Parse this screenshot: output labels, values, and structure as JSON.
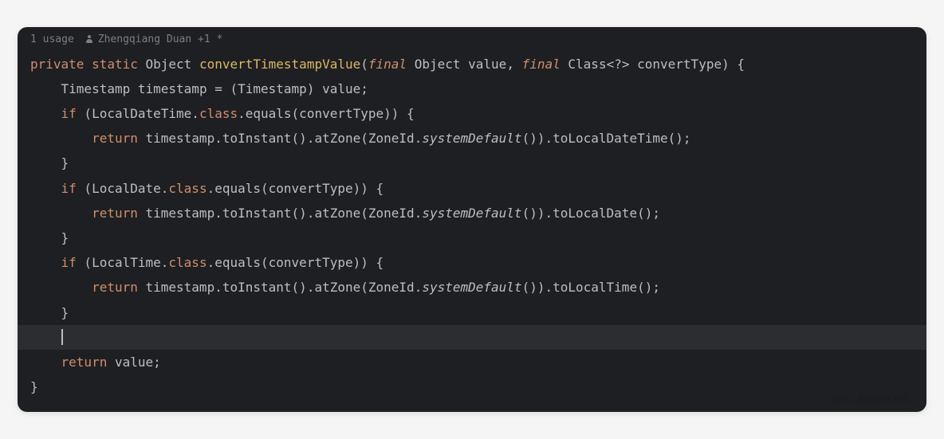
{
  "header": {
    "usage": "1 usage",
    "author": "Zhengqiang Duan +1 *"
  },
  "code": {
    "line1": {
      "kw1": "private",
      "kw2": "static",
      "type1": "Object",
      "method": "convertTimestampValue",
      "paren_open": "(",
      "kw3": "final",
      "type2": "Object",
      "param1": "value",
      "comma1": ",",
      "kw4": "final",
      "type3": "Class",
      "generic": "<?>",
      "param2": "convertType",
      "tail": ") {"
    },
    "line2": {
      "indent": "    ",
      "type": "Timestamp",
      "var": "timestamp",
      "assign": " = (",
      "cast": "Timestamp",
      "tail": ") value;"
    },
    "line3": {
      "indent": "    ",
      "kw": "if",
      "open": " (",
      "cls": "LocalDateTime",
      "dotclass": ".",
      "classfield": "class",
      "dot2": ".",
      "equals": "equals",
      "tail": "(convertType)) {"
    },
    "line4": {
      "indent": "        ",
      "kw": "return",
      "sp": " ",
      "obj": "timestamp",
      "dot1": ".",
      "m1": "toInstant",
      "p1": "()",
      "dot2": ".",
      "m2": "atZone",
      "p2o": "(",
      "zid": "ZoneId",
      "dot3": ".",
      "m3": "systemDefault",
      "p3": "())",
      "dot4": ".",
      "m4": "toLocalDateTime",
      "tail": "();"
    },
    "line5": {
      "text": "    }"
    },
    "line6": {
      "indent": "    ",
      "kw": "if",
      "open": " (",
      "cls": "LocalDate",
      "dotclass": ".",
      "classfield": "class",
      "dot2": ".",
      "equals": "equals",
      "tail": "(convertType)) {"
    },
    "line7": {
      "indent": "        ",
      "kw": "return",
      "sp": " ",
      "obj": "timestamp",
      "dot1": ".",
      "m1": "toInstant",
      "p1": "()",
      "dot2": ".",
      "m2": "atZone",
      "p2o": "(",
      "zid": "ZoneId",
      "dot3": ".",
      "m3": "systemDefault",
      "p3": "())",
      "dot4": ".",
      "m4": "toLocalDate",
      "tail": "();"
    },
    "line8": {
      "text": "    }"
    },
    "line9": {
      "indent": "    ",
      "kw": "if",
      "open": " (",
      "cls": "LocalTime",
      "dotclass": ".",
      "classfield": "class",
      "dot2": ".",
      "equals": "equals",
      "tail": "(convertType)) {"
    },
    "line10": {
      "indent": "        ",
      "kw": "return",
      "sp": " ",
      "obj": "timestamp",
      "dot1": ".",
      "m1": "toInstant",
      "p1": "()",
      "dot2": ".",
      "m2": "atZone",
      "p2o": "(",
      "zid": "ZoneId",
      "dot3": ".",
      "m3": "systemDefault",
      "p3": "())",
      "dot4": ".",
      "m4": "toLocalTime",
      "tail": "();"
    },
    "line11": {
      "text": "    }"
    },
    "line12": {
      "text": "    "
    },
    "line13": {
      "indent": "    ",
      "kw": "return",
      "tail": " value;"
    },
    "line14": {
      "text": "}"
    }
  },
  "watermark": "@稀土掘金技术社区"
}
